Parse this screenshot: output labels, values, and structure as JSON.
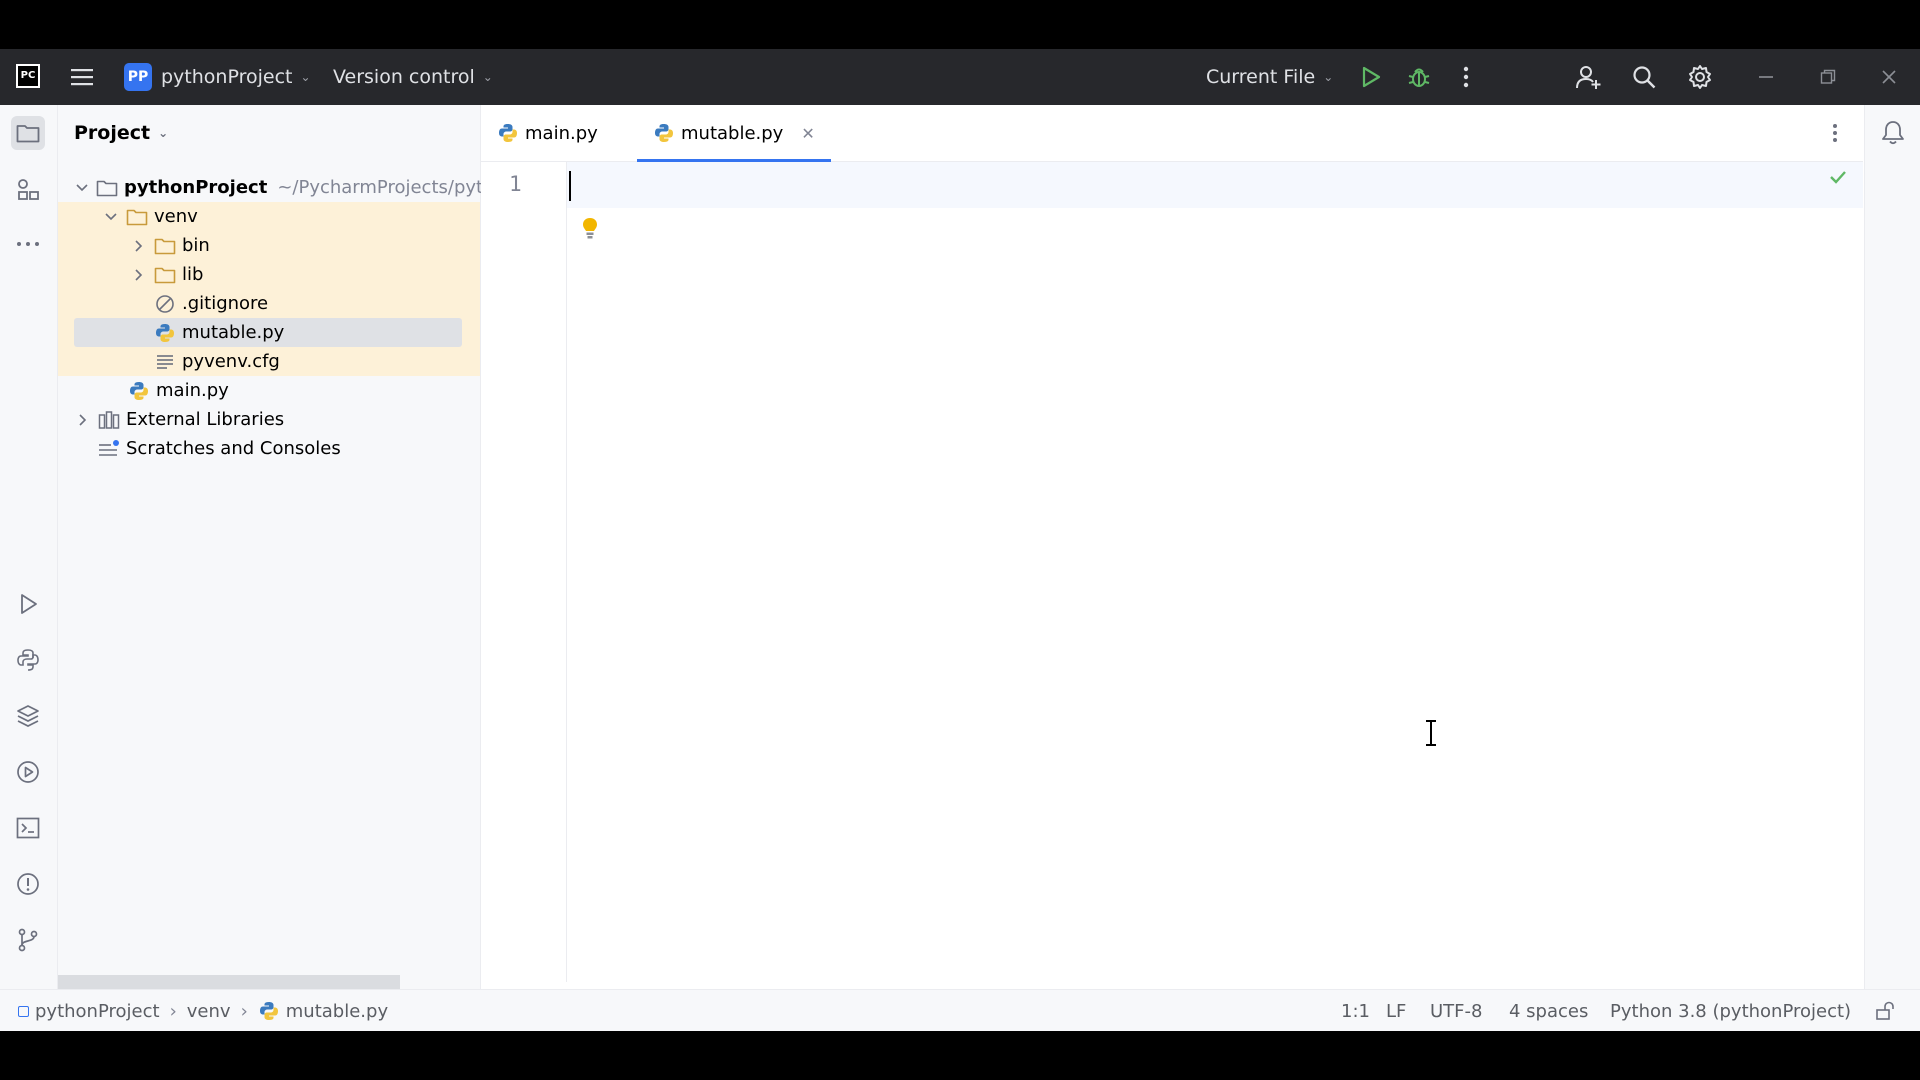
{
  "titlebar": {
    "logo": "PC",
    "project_badge": "PP",
    "project_name": "pythonProject",
    "vcs": "Version control",
    "run_config": "Current File",
    "icons": [
      "hamburger-menu-icon",
      "run-icon",
      "debug-icon",
      "more-vertical-icon",
      "add-user-icon",
      "search-icon",
      "settings-gear-icon",
      "minimize-icon",
      "restore-icon",
      "close-icon"
    ]
  },
  "project_panel": {
    "title": "Project",
    "tree": [
      {
        "label": "pythonProject",
        "hint": "~/PycharmProjects/pytho",
        "type": "folder",
        "expanded": true
      },
      {
        "label": "venv",
        "type": "folder",
        "expanded": true
      },
      {
        "label": "bin",
        "type": "folder",
        "expanded": false
      },
      {
        "label": "lib",
        "type": "folder",
        "expanded": false
      },
      {
        "label": ".gitignore",
        "type": "ignore-file"
      },
      {
        "label": "mutable.py",
        "type": "python-file",
        "selected": true
      },
      {
        "label": "pyvenv.cfg",
        "type": "config-file"
      },
      {
        "label": "main.py",
        "type": "python-file"
      },
      {
        "label": "External Libraries",
        "type": "libraries",
        "expanded": false
      },
      {
        "label": "Scratches and Consoles",
        "type": "scratches"
      }
    ]
  },
  "editor": {
    "tabs": [
      {
        "label": "main.py",
        "active": false
      },
      {
        "label": "mutable.py",
        "active": true
      }
    ],
    "line_numbers": [
      "1"
    ]
  },
  "statusbar": {
    "breadcrumbs": [
      "pythonProject",
      "venv",
      "mutable.py"
    ],
    "position": "1:1",
    "line_sep": "LF",
    "encoding": "UTF-8",
    "indent": "4 spaces",
    "interpreter": "Python 3.8 (pythonProject)"
  },
  "colors": {
    "accent": "#3574f0",
    "titlebar_bg": "#27282c",
    "highlight_row": "#fdf1d8",
    "selected_row": "#dfe1e5",
    "run_green": "#5fb865"
  }
}
